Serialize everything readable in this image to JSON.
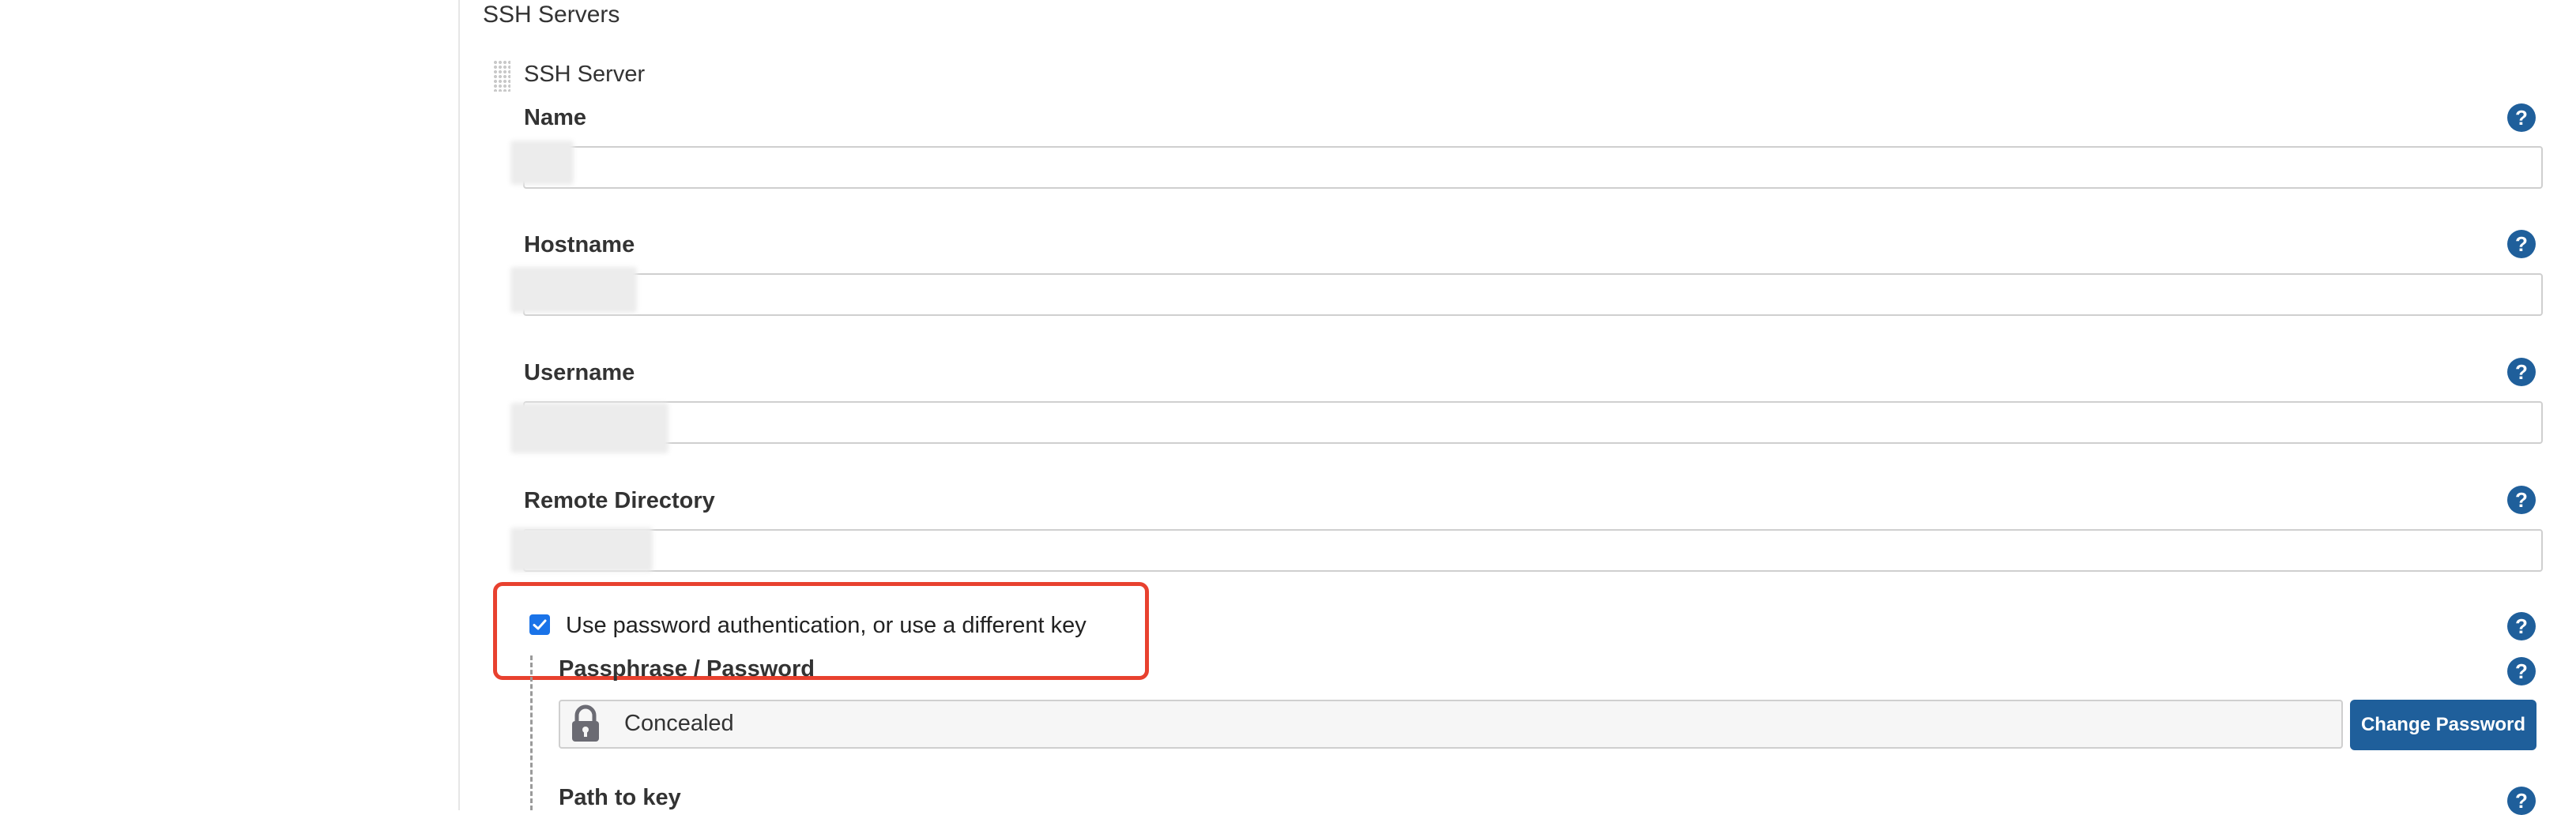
{
  "section_title": "SSH Servers",
  "ssh_server": {
    "title": "SSH Server",
    "fields": [
      {
        "label": "Name",
        "value": "",
        "help": "?"
      },
      {
        "label": "Hostname",
        "value": "",
        "help": "?"
      },
      {
        "label": "Username",
        "value": "",
        "help": "?"
      },
      {
        "label": "Remote Directory",
        "value": "",
        "help": "?"
      }
    ],
    "password_auth": {
      "checkbox_label": "Use password authentication, or use a different key",
      "checked": true,
      "help": "?"
    },
    "passphrase": {
      "label": "Passphrase / Password",
      "value": "Concealed",
      "button": "Change Password",
      "help": "?"
    },
    "path_to_key": {
      "label": "Path to key",
      "help": "?"
    }
  },
  "colors": {
    "help_icon": "#1f5f9b",
    "highlight": "#e8412f",
    "checkbox": "#1a73e8",
    "button": "#1f5f9b"
  }
}
